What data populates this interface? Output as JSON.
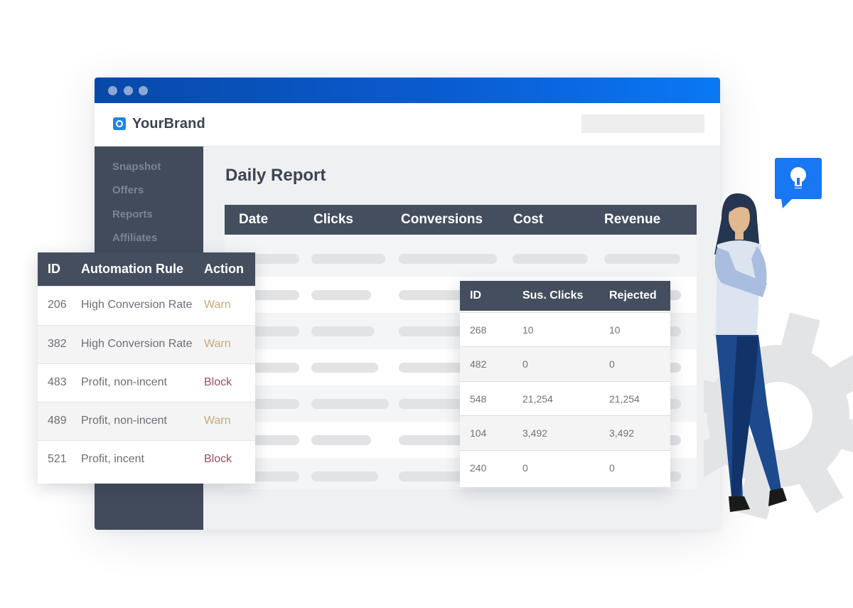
{
  "window": {
    "brand": "YourBrand",
    "brand_icon": "circle-logo-icon",
    "colors": {
      "titlebar_start": "#0849a8",
      "titlebar_end": "#0a78f5",
      "sidebar": "#424b5b",
      "table_header": "#454e5f",
      "warn": "#c8a779",
      "block": "#9c4d5c",
      "accent": "#1e86e8"
    }
  },
  "sidebar": {
    "items": [
      {
        "label": "Snapshot"
      },
      {
        "label": "Offers"
      },
      {
        "label": "Reports"
      },
      {
        "label": "Affiliates"
      }
    ]
  },
  "main": {
    "title": "Daily Report",
    "report_table": {
      "columns": [
        "Date",
        "Clicks",
        "Conversions",
        "Cost",
        "Revenue"
      ]
    }
  },
  "rules_card": {
    "columns": [
      "ID",
      "Automation Rule",
      "Action"
    ],
    "rows": [
      {
        "id": "206",
        "rule": "High Conversion Rate",
        "action": "Warn"
      },
      {
        "id": "382",
        "rule": "High Conversion Rate",
        "action": "Warn"
      },
      {
        "id": "483",
        "rule": "Profit, non-incent",
        "action": "Block"
      },
      {
        "id": "489",
        "rule": "Profit, non-incent",
        "action": "Warn"
      },
      {
        "id": "521",
        "rule": "Profit, incent",
        "action": "Block"
      }
    ]
  },
  "clicks_card": {
    "columns": [
      "ID",
      "Sus. Clicks",
      "Rejected"
    ],
    "rows": [
      {
        "id": "268",
        "sus_clicks": "10",
        "rejected": "10"
      },
      {
        "id": "482",
        "sus_clicks": "0",
        "rejected": "0"
      },
      {
        "id": "548",
        "sus_clicks": "21,254",
        "rejected": "21,254"
      },
      {
        "id": "104",
        "sus_clicks": "3,492",
        "rejected": "3,492"
      },
      {
        "id": "240",
        "sus_clicks": "0",
        "rejected": "0"
      }
    ]
  },
  "decorations": {
    "bubble_icon": "lightbulb-icon",
    "gear_icon": "gear-icon",
    "illustration": "woman-illustration"
  }
}
